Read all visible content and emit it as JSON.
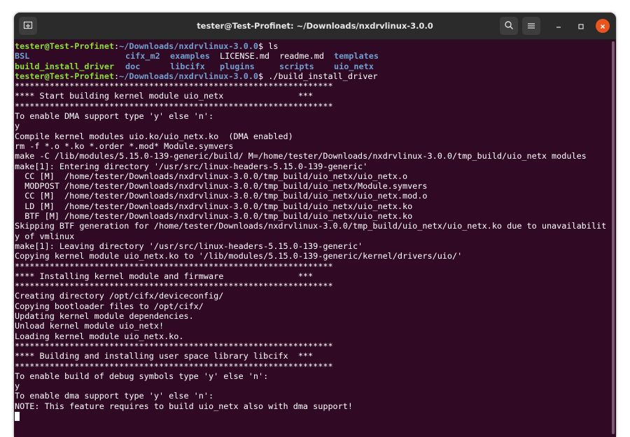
{
  "window": {
    "title": "tester@Test-Profinet: ~/Downloads/nxdrvlinux-3.0.0",
    "accent_close": "#e9541f",
    "background": "#300a24"
  },
  "titlebar_icons": [
    "new-tab-icon",
    "search-icon",
    "hamburger-menu-icon",
    "minimize-icon",
    "maximize-icon",
    "close-icon"
  ],
  "terminal": {
    "prompt_user": "tester@Test-Profinet",
    "prompt_path": "~/Downloads/nxdrvlinux-3.0.0",
    "cmd1": "ls",
    "ls_row1": {
      "c1": "BSL",
      "c2": "cifx_m2",
      "c3": "examples",
      "c4": "LICENSE.md",
      "c5": "readme.md",
      "c6": "templates"
    },
    "ls_row2": {
      "c1": "build_install_driver",
      "c2": "doc",
      "c3": "libcifx",
      "c4": "plugins",
      "c5": "scripts",
      "c6": "uio_netx"
    },
    "cmd2": "./build_install_driver",
    "lines": [
      "****************************************************************",
      "**** Start building kernel module uio_netx               ***",
      "****************************************************************",
      "To enable DMA support type 'y' else 'n':",
      "y",
      "Compile kernel modules uio.ko/uio_netx.ko  (DMA enabled)",
      "rm -f *.o *.ko *.order *.mod* Module.symvers",
      "make -C /lib/modules/5.15.0-139-generic/build/ M=/home/tester/Downloads/nxdrvlinux-3.0.0/tmp_build/uio_netx modules",
      "make[1]: Entering directory '/usr/src/linux-headers-5.15.0-139-generic'",
      "  CC [M]  /home/tester/Downloads/nxdrvlinux-3.0.0/tmp_build/uio_netx/uio_netx.o",
      "  MODPOST /home/tester/Downloads/nxdrvlinux-3.0.0/tmp_build/uio_netx/Module.symvers",
      "  CC [M]  /home/tester/Downloads/nxdrvlinux-3.0.0/tmp_build/uio_netx/uio_netx.mod.o",
      "  LD [M]  /home/tester/Downloads/nxdrvlinux-3.0.0/tmp_build/uio_netx/uio_netx.ko",
      "  BTF [M] /home/tester/Downloads/nxdrvlinux-3.0.0/tmp_build/uio_netx/uio_netx.ko",
      "Skipping BTF generation for /home/tester/Downloads/nxdrvlinux-3.0.0/tmp_build/uio_netx/uio_netx.ko due to unavailabilit",
      "y of vmlinux",
      "make[1]: Leaving directory '/usr/src/linux-headers-5.15.0-139-generic'",
      "Copying kernel module uio_netx.ko to '/lib/modules/5.15.0-139-generic/kernel/drivers/uio/'",
      "****************************************************************",
      "**** Installing kernel module and firmware               ***",
      "****************************************************************",
      "Creating directory /opt/cifx/deviceconfig/",
      "Copying bootloader files to /opt/cifx/",
      "Updating kernel module dependencies.",
      "Unload kernel module uio_netx!",
      "Loading kernel module uio_netx.ko.",
      "****************************************************************",
      "**** Building and installing user space library libcifx  ***",
      "****************************************************************",
      "To enable build of debug symbols type 'y' else 'n':",
      "y",
      "To enable dma support type 'y' else 'n':",
      "NOTE: This feature requires to build uio_netx also with dma support!"
    ]
  }
}
